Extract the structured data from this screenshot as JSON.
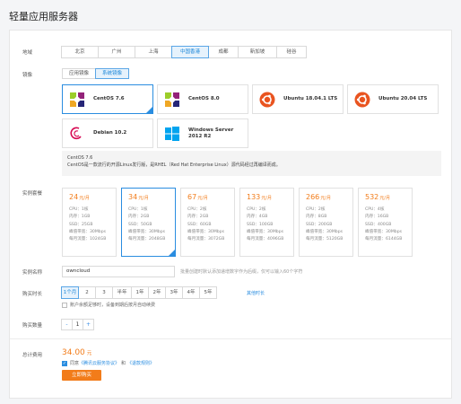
{
  "page_title": "轻量应用服务器",
  "labels": {
    "region": "地域",
    "image": "镜像",
    "instance": "实例套餐",
    "name": "实例名称",
    "duration": "购买时长",
    "quantity": "购买数量",
    "total": "总计费用"
  },
  "regions": [
    "北京",
    "广州",
    "上海",
    "中国香港",
    "成都",
    "新加坡",
    "硅谷"
  ],
  "region_selected": "中国香港",
  "image_tabs": [
    "应用镜像",
    "系统镜像"
  ],
  "image_tab_selected": "系统镜像",
  "os_images": [
    {
      "name": "CentOS 7.6",
      "icon": "centos-icon"
    },
    {
      "name": "CentOS 8.0",
      "icon": "centos-icon"
    },
    {
      "name": "Ubuntu 18.04.1 LTS",
      "icon": "ubuntu-icon"
    },
    {
      "name": "Ubuntu 20.04 LTS",
      "icon": "ubuntu-icon"
    },
    {
      "name": "Debian 10.2",
      "icon": "debian-icon"
    },
    {
      "name": "Windows Server 2012 R2",
      "icon": "windows-icon"
    }
  ],
  "os_selected": "CentOS 7.6",
  "os_description": {
    "line1": "CentOS 7.6",
    "line2": "CentOS是一款流行的开源Linux发行版，是RHEL（Red Hat Enterprise Linux）源代码经过再编译而成。"
  },
  "plans": [
    {
      "price": "24",
      "unit": "元/月",
      "cpu": "CPU：1核",
      "mem": "内存：1GB",
      "ssd": "SSD：25GB",
      "bw": "峰值带宽：30Mbps",
      "traffic": "每月流量：1024GB"
    },
    {
      "price": "34",
      "unit": "元/月",
      "cpu": "CPU：1核",
      "mem": "内存：2GB",
      "ssd": "SSD：50GB",
      "bw": "峰值带宽：30Mbps",
      "traffic": "每月流量：2048GB"
    },
    {
      "price": "67",
      "unit": "元/月",
      "cpu": "CPU：2核",
      "mem": "内存：2GB",
      "ssd": "SSD：60GB",
      "bw": "峰值带宽：30Mbps",
      "traffic": "每月流量：3072GB"
    },
    {
      "price": "133",
      "unit": "元/月",
      "cpu": "CPU：2核",
      "mem": "内存：4GB",
      "ssd": "SSD：100GB",
      "bw": "峰值带宽：30Mbps",
      "traffic": "每月流量：4096GB"
    },
    {
      "price": "266",
      "unit": "元/月",
      "cpu": "CPU：2核",
      "mem": "内存：8GB",
      "ssd": "SSD：200GB",
      "bw": "峰值带宽：30Mbps",
      "traffic": "每月流量：5120GB"
    },
    {
      "price": "532",
      "unit": "元/月",
      "cpu": "CPU：4核",
      "mem": "内存：16GB",
      "ssd": "SSD：400GB",
      "bw": "峰值带宽：30Mbps",
      "traffic": "每月流量：6144GB"
    }
  ],
  "plan_selected": "34",
  "instance_name": "owncloud",
  "instance_name_hint": "批量创建时默认添加递增数字作为后缀，仅可以输入60个字符",
  "durations": [
    "1个月",
    "2",
    "3",
    "半年",
    "1年",
    "2年",
    "3年",
    "4年",
    "5年"
  ],
  "duration_selected": "1个月",
  "duration_more": "其他时长",
  "auto_renew": "账户余额足够时，设备到期后按月自动续费",
  "quantity": {
    "minus": "-",
    "value": "1",
    "plus": "+"
  },
  "total": {
    "value": "34.00",
    "unit": "元"
  },
  "agreement": {
    "prefix": "同意",
    "link1": "《腾讯云服务协议》",
    "and": "和",
    "link2": "《退款规则》"
  },
  "buy_button": "立即购买",
  "colors": {
    "accent": "#2a8de0",
    "price": "#f27c1a"
  }
}
